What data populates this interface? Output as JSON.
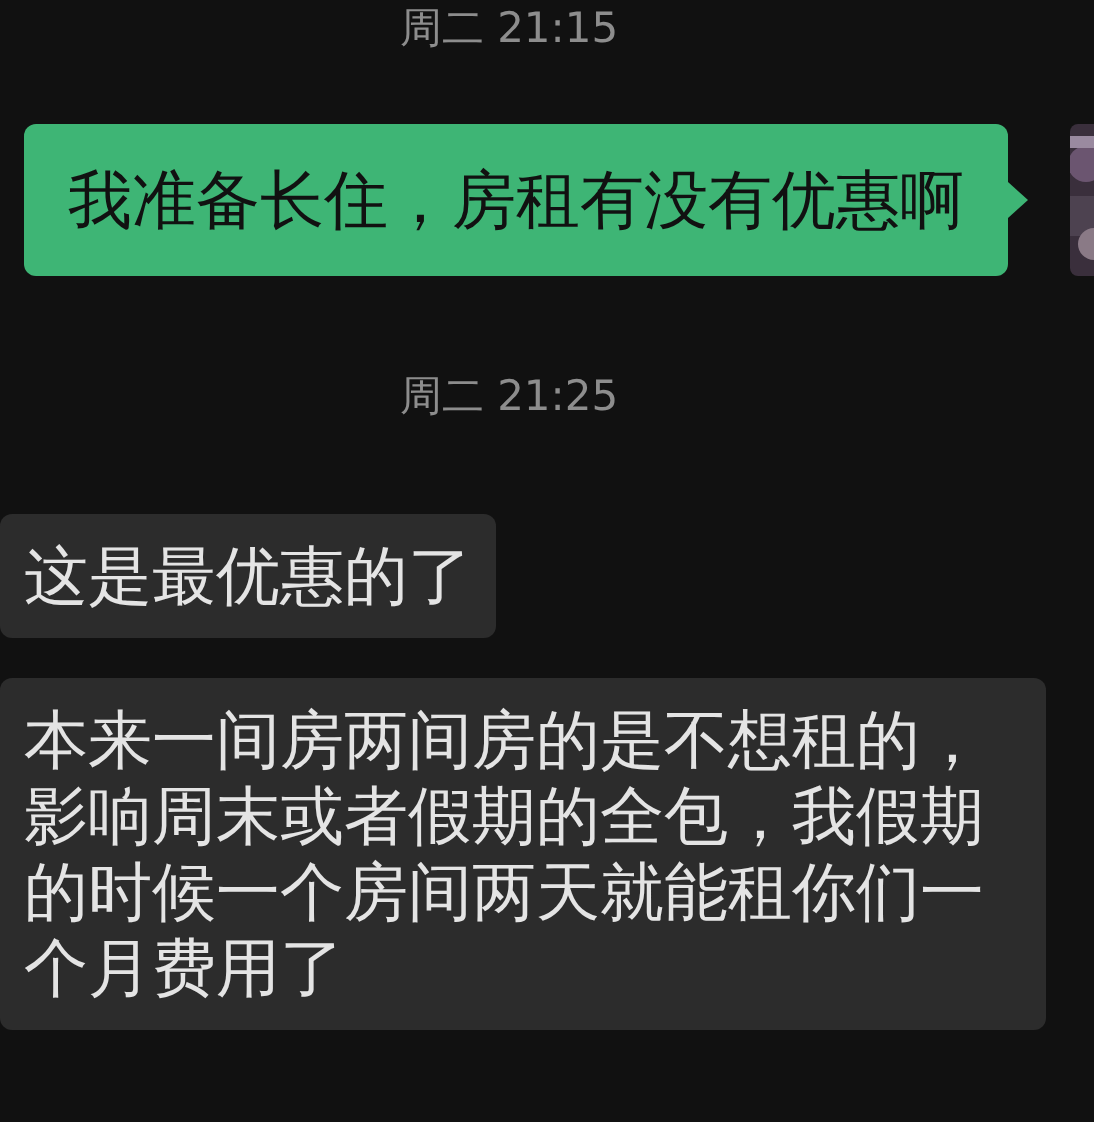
{
  "messages": [
    {
      "kind": "time",
      "text": "周二 21:15"
    },
    {
      "kind": "sent",
      "text": "我准备长住，房租有没有优惠啊"
    },
    {
      "kind": "time",
      "text": "周二 21:25"
    },
    {
      "kind": "received",
      "text": "这是最优惠的了"
    },
    {
      "kind": "received",
      "text": "本来一间房两间房的是不想租的，影响周末或者假期的全包，我假期的时候一个房间两天就能租你们一个月费用了"
    }
  ]
}
